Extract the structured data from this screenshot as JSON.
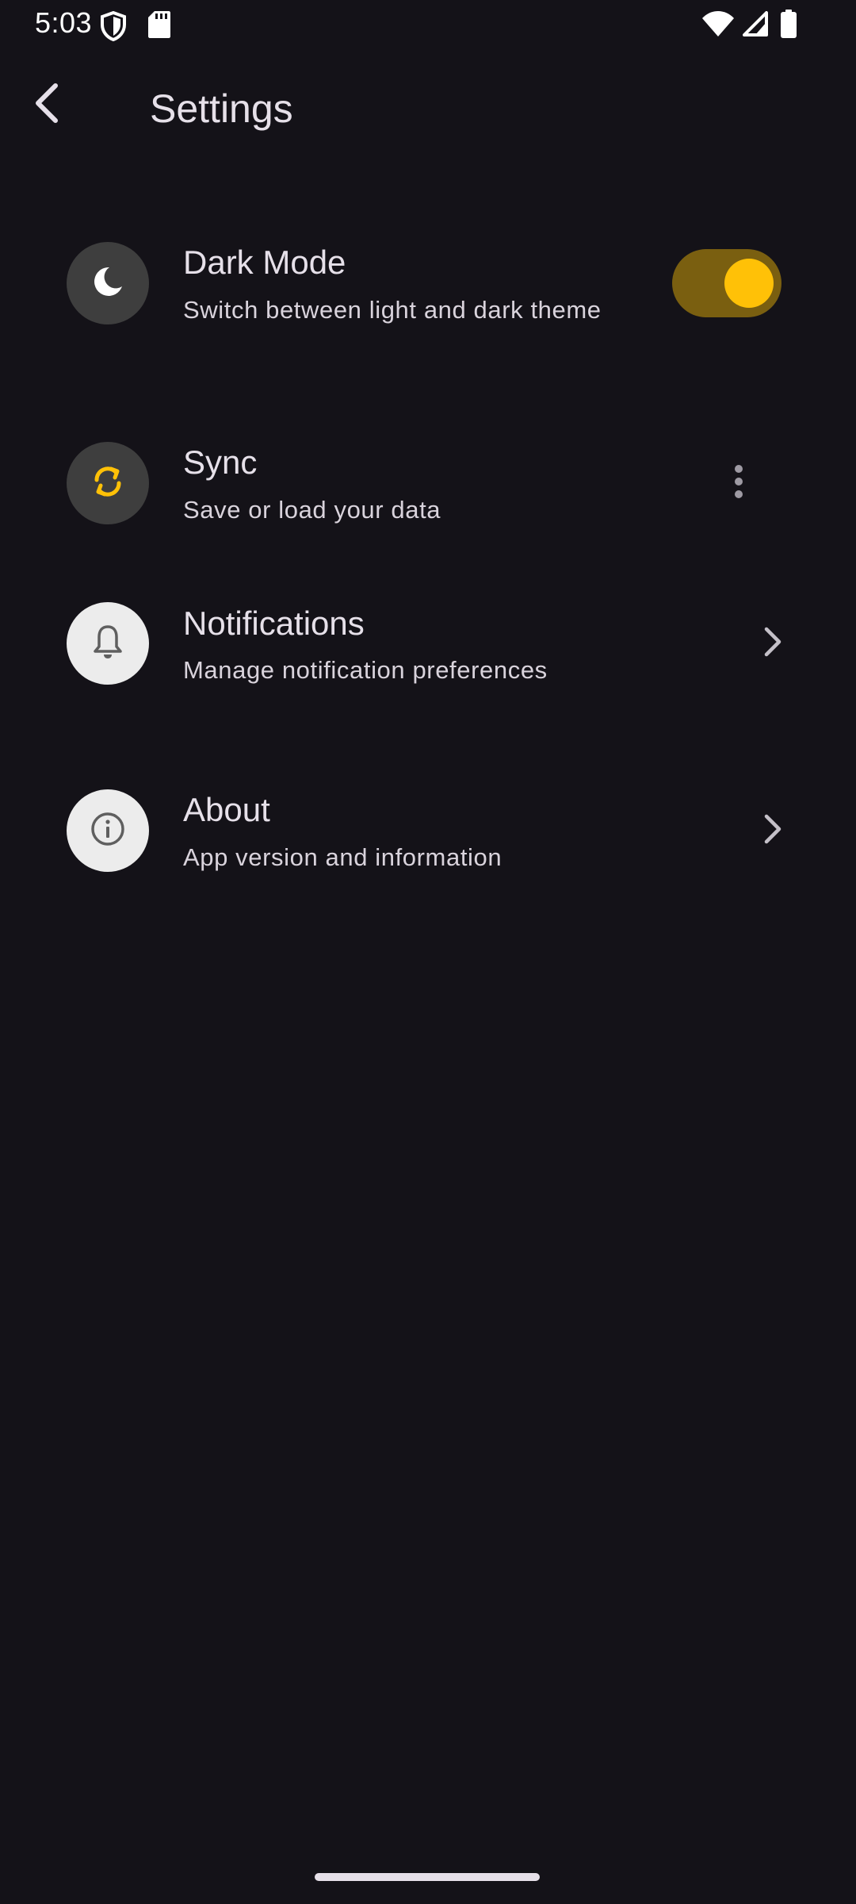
{
  "status_bar": {
    "time": "5:03",
    "icons": [
      "shield-icon",
      "sd-card-icon",
      "wifi-icon",
      "cellular-signal-icon",
      "battery-icon"
    ]
  },
  "app_bar": {
    "back_icon": "arrow-back-icon",
    "title": "Settings"
  },
  "settings": [
    {
      "title": "Dark Mode",
      "subtitle": "Switch between light and dark theme",
      "icon": "moon-icon",
      "control": "toggle",
      "enabled": true
    },
    {
      "title": "Sync",
      "subtitle": "Save or load your data",
      "icon": "sync-icon",
      "control": "more-vert-icon"
    },
    {
      "title": "Notifications",
      "subtitle": "Manage notification preferences",
      "icon": "bell-icon",
      "control": "chevron-right-icon"
    },
    {
      "title": "About",
      "subtitle": "App version and information",
      "icon": "info-icon",
      "control": "chevron-right-icon"
    }
  ],
  "colors": {
    "background": "#141218",
    "text": "#e6e0e9",
    "accent": "#ffc107",
    "toggle_track": "#7a5f10"
  }
}
